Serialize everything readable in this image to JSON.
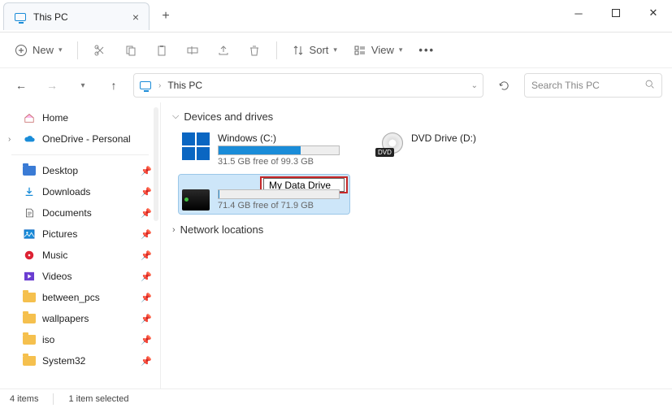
{
  "window": {
    "tab_title": "This PC"
  },
  "toolbar": {
    "new": "New",
    "sort": "Sort",
    "view": "View"
  },
  "addressbar": {
    "path": "This PC"
  },
  "search": {
    "placeholder": "Search This PC"
  },
  "sidebar": {
    "home": "Home",
    "onedrive": "OneDrive - Personal",
    "quick": [
      {
        "label": "Desktop"
      },
      {
        "label": "Downloads"
      },
      {
        "label": "Documents"
      },
      {
        "label": "Pictures"
      },
      {
        "label": "Music"
      },
      {
        "label": "Videos"
      },
      {
        "label": "between_pcs"
      },
      {
        "label": "wallpapers"
      },
      {
        "label": "iso"
      },
      {
        "label": "System32"
      }
    ]
  },
  "sections": {
    "devices_drives": "Devices and drives",
    "network_locations": "Network locations"
  },
  "drives": {
    "c": {
      "name": "Windows (C:)",
      "free": "31.5 GB free of 99.3 GB",
      "fill_pct": 68
    },
    "e": {
      "name": "My Data Drive",
      "free": "71.4 GB free of 71.9 GB",
      "fill_pct": 1
    },
    "dvd": {
      "name": "DVD Drive (D:)",
      "badge": "DVD"
    }
  },
  "status": {
    "items": "4 items",
    "selected": "1 item selected"
  }
}
